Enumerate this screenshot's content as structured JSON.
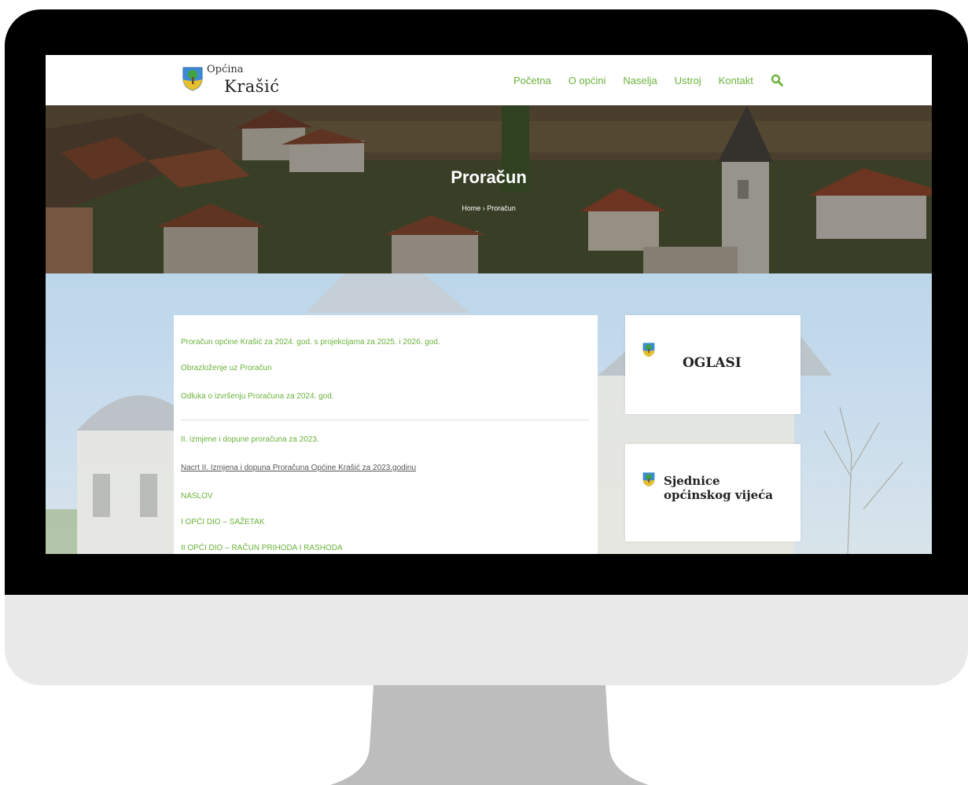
{
  "header": {
    "logo_top": "Općina",
    "logo_bottom": "Krašić",
    "nav": [
      "Početna",
      "O općini",
      "Naselja",
      "Ustroj",
      "Kontakt"
    ]
  },
  "hero": {
    "title": "Proračun",
    "breadcrumb": "Home › Proračun"
  },
  "main": {
    "items": [
      "Proračun općine Krašić za 2024. god. s projekcijama za 2025. i 2026. god.",
      "Obrazloženje uz Proračun",
      "Odluka o izvršenju Proračuna za 2024. god.",
      "II. izmjene i dopune proračuna za 2023.",
      "Nacrt II. Izmjena i dopuna Proračuna Općine Krašić za 2023.godinu",
      "NASLOV",
      "I OPĆI DIO – SAŽETAK",
      "II OPĆI DIO – RAČUN PRIHODA I RASHODA"
    ]
  },
  "sidebar": {
    "oglasi": "OGLASI",
    "sjednice_line1": "Sjednice",
    "sjednice_line2": "općinskog vijeća"
  },
  "colors": {
    "accent_green": "#6bb23b",
    "bezel": "#000000",
    "monitor_body": "#e9e9e9",
    "stand": "#bdbdbd"
  },
  "icons": {
    "logo": "coat-of-arms-icon",
    "search": "search-icon"
  }
}
